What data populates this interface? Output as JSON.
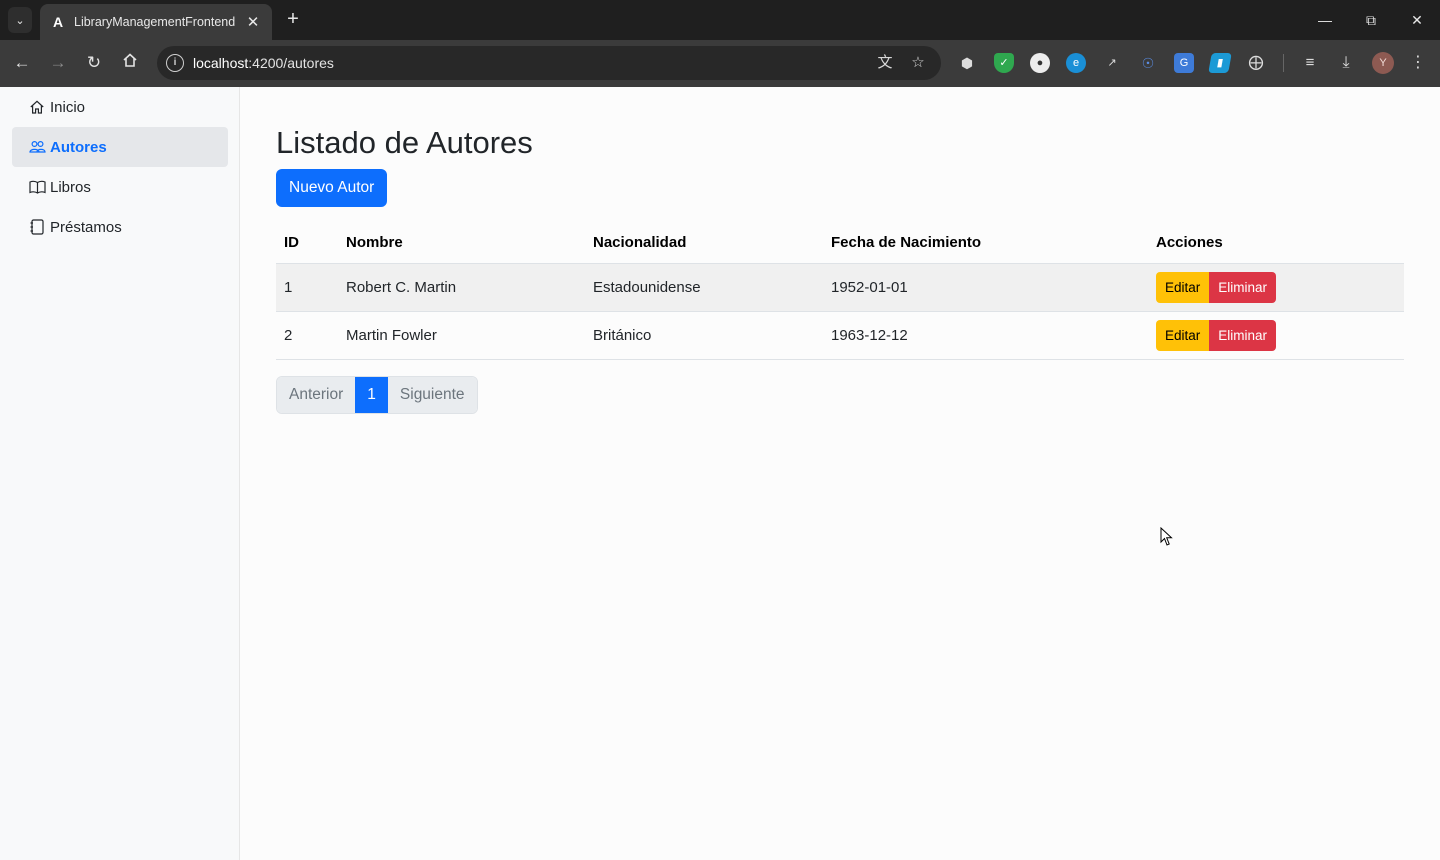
{
  "browser": {
    "tab_title": "LibraryManagementFrontend",
    "url_host": "localhost",
    "url_rest": ":4200/autores",
    "avatar_letter": "Y"
  },
  "sidebar": {
    "items": [
      {
        "label": "Inicio",
        "icon": "house-icon"
      },
      {
        "label": "Autores",
        "icon": "people-icon",
        "active": true
      },
      {
        "label": "Libros",
        "icon": "book-icon"
      },
      {
        "label": "Préstamos",
        "icon": "journal-icon"
      }
    ]
  },
  "main": {
    "title": "Listado de Autores",
    "new_button": "Nuevo Autor",
    "table": {
      "headers": [
        "ID",
        "Nombre",
        "Nacionalidad",
        "Fecha de Nacimiento",
        "Acciones"
      ],
      "rows": [
        {
          "id": "1",
          "nombre": "Robert C. Martin",
          "nacionalidad": "Estadounidense",
          "fecha": "1952-01-01",
          "edit": "Editar",
          "delete": "Eliminar"
        },
        {
          "id": "2",
          "nombre": "Martin Fowler",
          "nacionalidad": "Británico",
          "fecha": "1963-12-12",
          "edit": "Editar",
          "delete": "Eliminar"
        }
      ]
    },
    "pagination": {
      "prev": "Anterior",
      "current": "1",
      "next": "Siguiente"
    }
  },
  "colors": {
    "primary": "#0d6efd",
    "warning": "#ffc107",
    "danger": "#dc3545"
  }
}
